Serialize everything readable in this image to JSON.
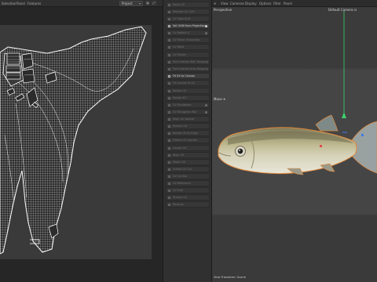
{
  "uv_editor": {
    "menu": [
      "Selection",
      "Panel",
      "Features"
    ],
    "mode_select": "Project"
  },
  "commands": [
    {
      "label": "Relax UV",
      "active": false
    },
    {
      "label": "Relaxed UV 10%",
      "active": false
    },
    {
      "label": "UV Tape Grid",
      "active": false
    },
    {
      "label": "Set UVW from Projection",
      "active": true
    },
    {
      "label": "UV Reflect X",
      "active": false
    },
    {
      "label": "UV Mirror Horizontal",
      "active": false
    },
    {
      "label": "UV Weld",
      "active": false
    },
    {
      "label": "UV Packer",
      "active": false
    },
    {
      "label": "Pack Islands With Mapping",
      "active": false
    },
    {
      "label": "Pack Islands Area Mapping",
      "active": false
    },
    {
      "label": "Fit UV to Canvas",
      "active": true
    },
    {
      "label": "Fit Canvas To UV",
      "active": false
    },
    {
      "label": "Rotate UV",
      "active": false
    },
    {
      "label": "Rotate 90°",
      "active": false
    },
    {
      "label": "UV Straighten",
      "active": false
    },
    {
      "label": "UV Straighten Bar",
      "active": false
    },
    {
      "label": "Align UV Islands",
      "active": false
    },
    {
      "label": "Stretch UV",
      "active": false
    },
    {
      "label": "Rotate UV by Edge",
      "active": false
    },
    {
      "label": "Flatten UV Islands",
      "active": false
    },
    {
      "label": "Layout UV",
      "active": false
    },
    {
      "label": "Align UV",
      "active": false
    },
    {
      "label": "Match UV",
      "active": false
    },
    {
      "label": "Unfold UV Cut",
      "active": false
    },
    {
      "label": "UV Cut Bar",
      "active": false
    },
    {
      "label": "UV Reference",
      "active": false
    },
    {
      "label": "UV Fold",
      "active": false
    },
    {
      "label": "Terrace UV",
      "active": false
    },
    {
      "label": "Reverse",
      "active": false
    }
  ],
  "viewport": {
    "menu": [
      "View",
      "Cameras",
      "Display",
      "Options",
      "Filter",
      "Panel"
    ],
    "view_name": "Perspective",
    "camera": "Default Camera",
    "tool_label": "Move",
    "footer": "View Transform: Scene"
  },
  "colors": {
    "uv_background": "#3a3a3a",
    "uv_wire": "#ffffff",
    "fish_body": "#b9b48b",
    "selection_outline": "#e0883a",
    "axis_green": "#3fcf6a",
    "axis_blue": "#3b7de8",
    "axis_red": "#e04a4a"
  }
}
